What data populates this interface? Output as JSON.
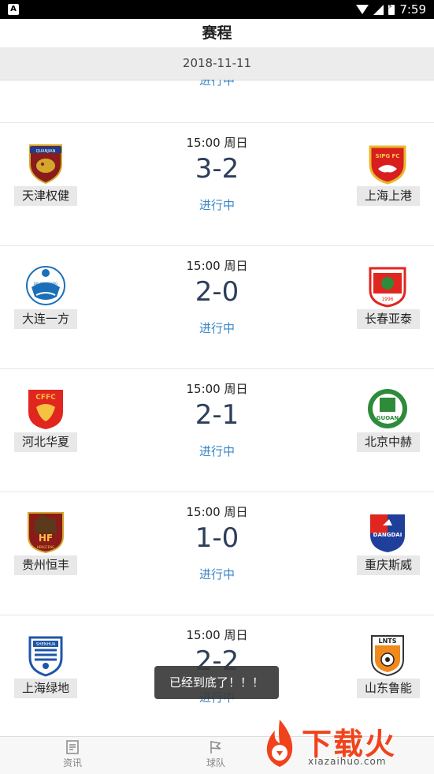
{
  "status_bar": {
    "left_icon": "A",
    "time": "7:59"
  },
  "header": {
    "title": "赛程"
  },
  "date": "2018-11-11",
  "partial_match": {
    "status": "进行中"
  },
  "matches": [
    {
      "time": "15:00 周日",
      "score": "3-2",
      "status": "进行中",
      "home": {
        "name": "天津权健",
        "logo_text": "QUANJIAN",
        "color": "#c0392b"
      },
      "away": {
        "name": "上海上港",
        "logo_text": "SIPG FC",
        "color": "#d81e1e"
      }
    },
    {
      "time": "15:00 周日",
      "score": "2-0",
      "status": "进行中",
      "home": {
        "name": "大连一方",
        "logo_text": "DALIAN YIFANG",
        "color": "#1b6fb8"
      },
      "away": {
        "name": "长春亚泰",
        "logo_text": "1996",
        "color": "#e0261f"
      }
    },
    {
      "time": "15:00 周日",
      "score": "2-1",
      "status": "进行中",
      "home": {
        "name": "河北华夏",
        "logo_text": "CFFC",
        "color": "#e0261f"
      },
      "away": {
        "name": "北京中赫",
        "logo_text": "GUOAN",
        "color": "#2e8b3a"
      }
    },
    {
      "time": "15:00 周日",
      "score": "1-0",
      "status": "进行中",
      "home": {
        "name": "贵州恒丰",
        "logo_text": "HENGFENG",
        "color": "#8b1a1a"
      },
      "away": {
        "name": "重庆斯威",
        "logo_text": "DANGDAI",
        "color": "#1f3f9a"
      }
    },
    {
      "time": "15:00 周日",
      "score": "2-2",
      "status": "进行中",
      "home": {
        "name": "上海绿地",
        "logo_text": "SHENHUA",
        "color": "#1f55a8"
      },
      "away": {
        "name": "山东鲁能",
        "logo_text": "LNTS",
        "color": "#f08a1c"
      }
    }
  ],
  "toast": "已经到底了！！！",
  "tabs": [
    {
      "label": "资讯",
      "icon": "news-icon"
    },
    {
      "label": "球队",
      "icon": "flag-icon"
    }
  ],
  "watermark": {
    "text": "下载火",
    "url": "xiazaihuo.com"
  }
}
